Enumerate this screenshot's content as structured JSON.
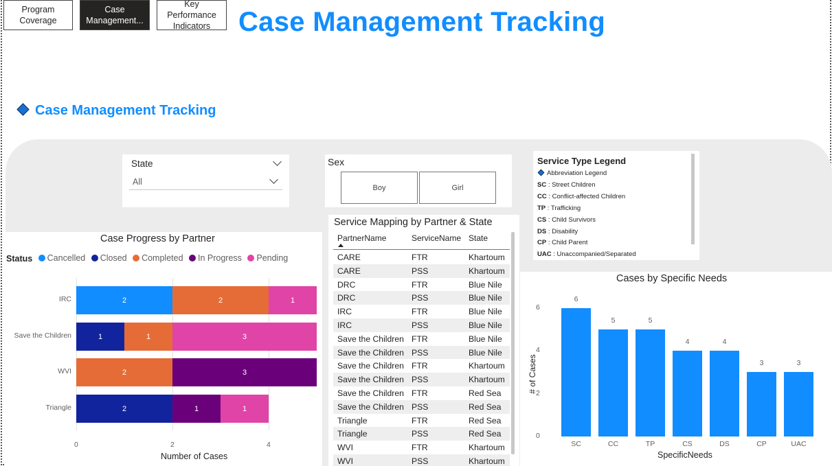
{
  "nav": {
    "buttons": [
      {
        "label": "Program\nCoverage"
      },
      {
        "label": "Case\nManagement..."
      },
      {
        "label": "Key Performance\nIndicators"
      }
    ]
  },
  "header": {
    "title": "Case Management Tracking"
  },
  "section": {
    "title": "Case Management Tracking"
  },
  "state_slicer": {
    "label": "State",
    "selected": "All"
  },
  "sex_slicer": {
    "label": "Sex",
    "options": [
      "Boy",
      "Girl"
    ]
  },
  "service_legend": {
    "title": "Service Type Legend",
    "subtitle": "Abbreviation Legend",
    "items": [
      {
        "code": "SC",
        "desc": "Street Children"
      },
      {
        "code": "CC",
        "desc": "Conflict-affected Children"
      },
      {
        "code": "TP",
        "desc": "Trafficking"
      },
      {
        "code": "CS",
        "desc": "Child Survivors"
      },
      {
        "code": "DS",
        "desc": "Disability"
      },
      {
        "code": "CP",
        "desc": "Child Parent"
      },
      {
        "code": "UAC",
        "desc": "Unaccompanied/Separated"
      }
    ]
  },
  "service_table": {
    "title": "Service Mapping by Partner & State",
    "columns": [
      "PartnerName",
      "ServiceName",
      "State"
    ],
    "rows": [
      [
        "CARE",
        "FTR",
        "Khartoum"
      ],
      [
        "CARE",
        "PSS",
        "Khartoum"
      ],
      [
        "DRC",
        "FTR",
        "Blue Nile"
      ],
      [
        "DRC",
        "PSS",
        "Blue Nile"
      ],
      [
        "IRC",
        "FTR",
        "Blue Nile"
      ],
      [
        "IRC",
        "PSS",
        "Blue Nile"
      ],
      [
        "Save the Children",
        "FTR",
        "Blue Nile"
      ],
      [
        "Save the Children",
        "PSS",
        "Blue Nile"
      ],
      [
        "Save the Children",
        "FTR",
        "Khartoum"
      ],
      [
        "Save the Children",
        "PSS",
        "Khartoum"
      ],
      [
        "Save the Children",
        "FTR",
        "Red Sea"
      ],
      [
        "Save the Children",
        "PSS",
        "Red Sea"
      ],
      [
        "Triangle",
        "FTR",
        "Red Sea"
      ],
      [
        "Triangle",
        "PSS",
        "Red Sea"
      ],
      [
        "WVI",
        "FTR",
        "Khartoum"
      ],
      [
        "WVI",
        "PSS",
        "Khartoum"
      ]
    ]
  },
  "colors": {
    "accent": "#118DFF",
    "cancelled": "#118DFF",
    "closed": "#12239E",
    "completed": "#E66C37",
    "in_progress": "#6B007B",
    "pending": "#E044A7"
  },
  "chart_data": [
    {
      "type": "bar",
      "orientation": "horizontal",
      "stacked": true,
      "title": "Case Progress by Partner",
      "legend_title": "Status",
      "legend_position": "top-left",
      "categories": [
        "IRC",
        "Save the Children",
        "WVI",
        "Triangle"
      ],
      "series": [
        {
          "name": "Cancelled",
          "values": [
            2,
            0,
            0,
            0
          ]
        },
        {
          "name": "Closed",
          "values": [
            0,
            1,
            0,
            2
          ]
        },
        {
          "name": "Completed",
          "values": [
            2,
            1,
            2,
            0
          ]
        },
        {
          "name": "In Progress",
          "values": [
            0,
            0,
            3,
            1
          ]
        },
        {
          "name": "Pending",
          "values": [
            1,
            3,
            0,
            1
          ]
        }
      ],
      "xlabel": "Number of Cases",
      "ylabel": "",
      "xlim": [
        0,
        5
      ],
      "xticks": [
        "0",
        "2",
        "4"
      ]
    },
    {
      "type": "bar",
      "title": "Cases by Specific Needs",
      "categories": [
        "SC",
        "CC",
        "TP",
        "CS",
        "DS",
        "CP",
        "UAC"
      ],
      "values": [
        6,
        5,
        5,
        4,
        4,
        3,
        3
      ],
      "xlabel": "SpecificNeeds",
      "ylabel": "# of Cases",
      "ylim": [
        0,
        6.6
      ],
      "yticks": [
        "0",
        "2",
        "4",
        "6"
      ]
    }
  ]
}
